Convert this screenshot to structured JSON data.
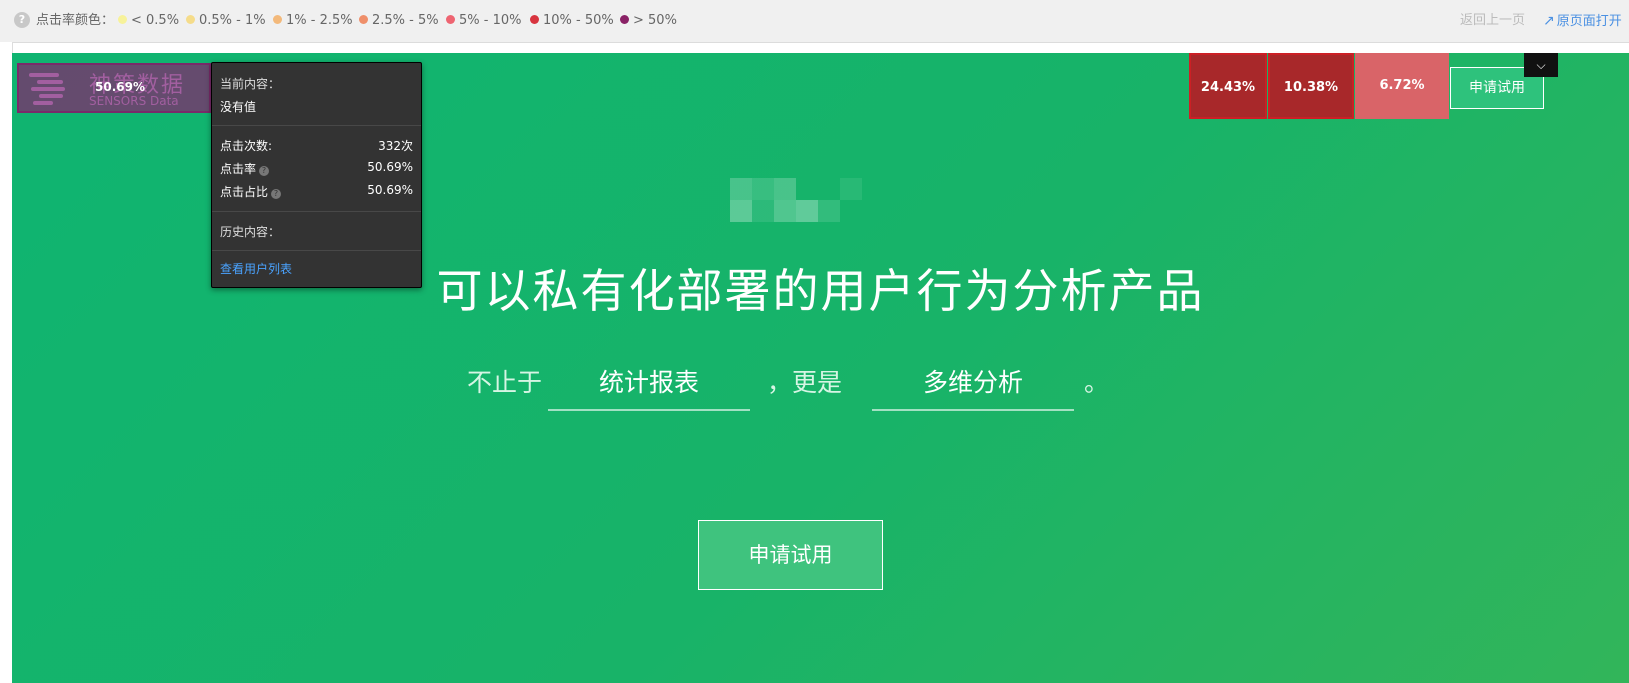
{
  "legend": {
    "title": "点击率颜色：",
    "items": [
      {
        "label": "< 0.5%",
        "color": "#f7f29a"
      },
      {
        "label": "0.5% - 1%",
        "color": "#f5dc8a"
      },
      {
        "label": "1% - 2.5%",
        "color": "#f3b97b"
      },
      {
        "label": "2.5% - 5%",
        "color": "#ef8f6a"
      },
      {
        "label": "5% - 10%",
        "color": "#ee6471"
      },
      {
        "label": "10% - 50%",
        "color": "#d8343f"
      },
      {
        "label": "> 50%",
        "color": "#8a2266"
      }
    ]
  },
  "nav_links": {
    "back": "返回上一页",
    "open_original": "原页面打开"
  },
  "logo": {
    "cn": "神策数据",
    "en": "SENSORS Data",
    "click_rate": "50.69%"
  },
  "tooltip": {
    "current_content_label": "当前内容：",
    "current_content_value": "没有值",
    "click_count_label": "点击次数:",
    "click_count_value": "332次",
    "click_rate_label": "点击率",
    "click_rate_value": "50.69%",
    "click_share_label": "点击占比",
    "click_share_value": "50.69%",
    "history_label": "历史内容：",
    "user_list_link": "查看用户列表"
  },
  "heat_cells": [
    {
      "value": "24.43%",
      "color": "#a8282a"
    },
    {
      "value": "10.38%",
      "color": "#a8282a"
    },
    {
      "value": "6.72%",
      "color": "#d96468"
    }
  ],
  "header": {
    "trial_button": "申请试用"
  },
  "hero": {
    "headline": "可以私有化部署的用户行为分析产品",
    "prefix": "不止于",
    "word_1": "统计报表",
    "middle": "，更是",
    "word_2": "多维分析",
    "suffix": "。",
    "trial_button": "申请试用"
  }
}
